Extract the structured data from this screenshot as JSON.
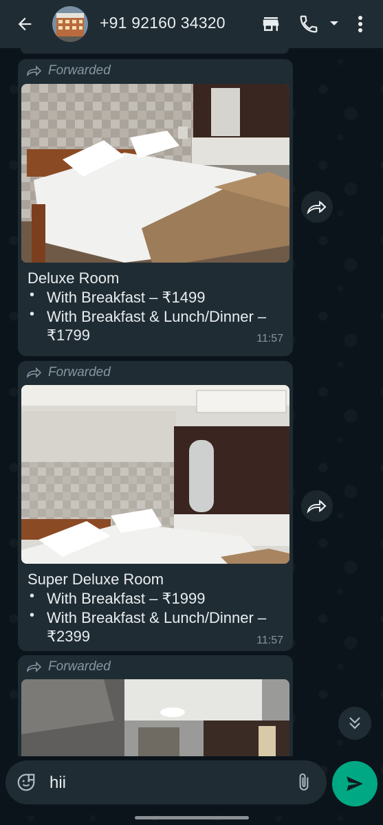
{
  "header": {
    "contact_name": "+91 92160 34320",
    "icons": [
      "back-arrow-icon",
      "shop-icon",
      "call-icon",
      "dropdown-icon",
      "more-icon"
    ]
  },
  "messages": [
    {
      "forwarded_label": "Forwarded",
      "title": "Deluxe Room",
      "items": [
        "With Breakfast – ₹1499",
        "With Breakfast & Lunch/Dinner –",
        "₹1799"
      ],
      "time": "11:57"
    },
    {
      "forwarded_label": "Forwarded",
      "title": "Super Deluxe Room",
      "items": [
        "With Breakfast – ₹1999",
        "With Breakfast & Lunch/Dinner –",
        "₹2399"
      ],
      "time": "11:57"
    },
    {
      "forwarded_label": "Forwarded"
    }
  ],
  "composer": {
    "input_value": "hii"
  },
  "colors": {
    "background": "#0b141a",
    "header": "#1f2c34",
    "bubble": "#1f2c34",
    "accent_send": "#00a884",
    "muted_text": "#8696a0"
  }
}
